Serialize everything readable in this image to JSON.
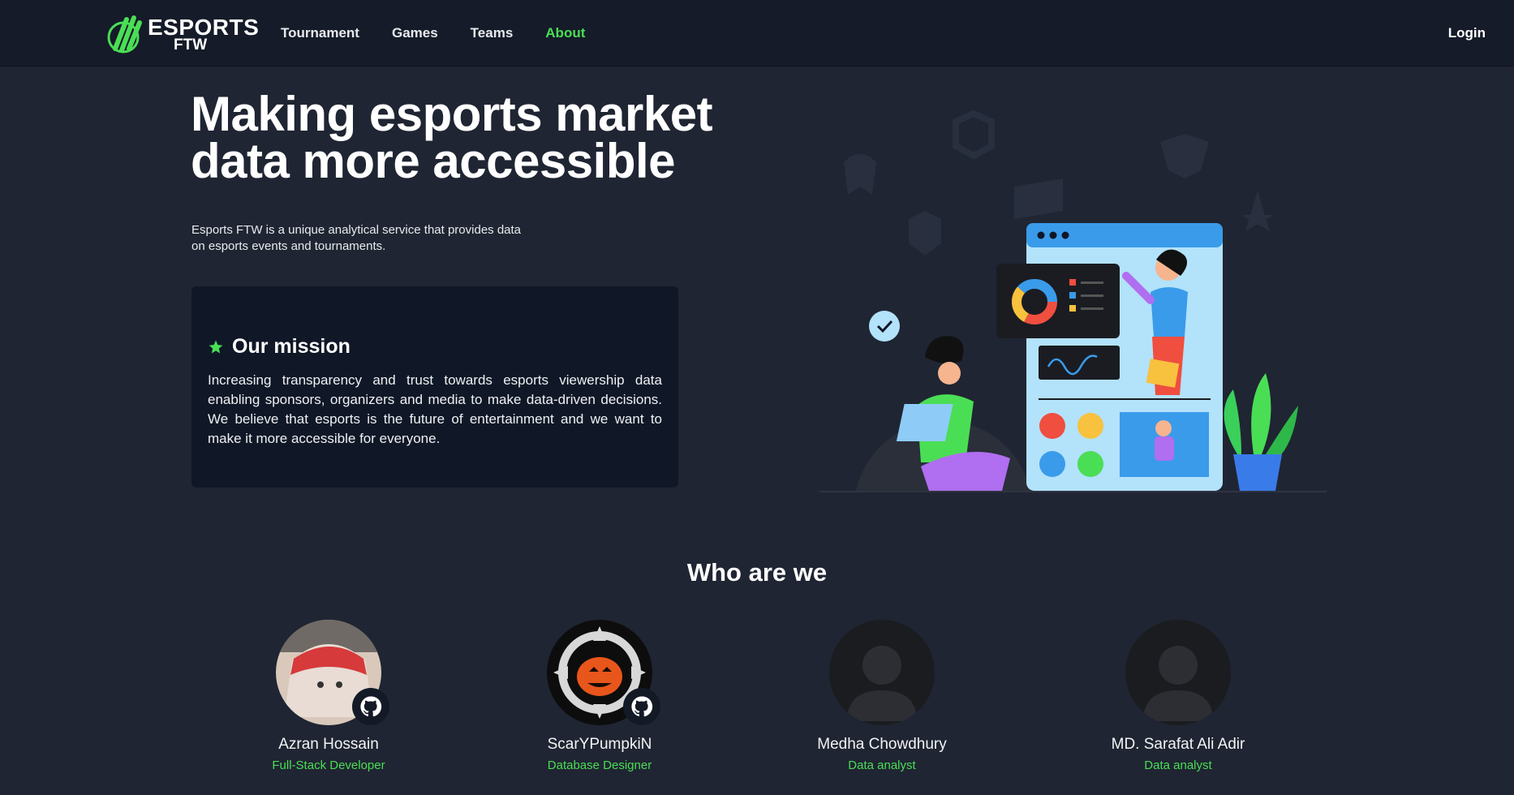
{
  "brand": {
    "line1": "ESPORTS",
    "line2": "FTW",
    "accent": "#4ade55"
  },
  "nav": {
    "links": [
      {
        "label": "Tournament",
        "active": false
      },
      {
        "label": "Games",
        "active": false
      },
      {
        "label": "Teams",
        "active": false
      },
      {
        "label": "About",
        "active": true
      }
    ],
    "login": "Login"
  },
  "hero": {
    "title_line1": "Making esports market",
    "title_line2": "data more accessible",
    "subtitle": "Esports FTW is a unique analytical service that provides data on esports events and tournaments."
  },
  "mission": {
    "icon": "star-icon",
    "title": "Our mission",
    "text": "Increasing transparency and trust towards esports viewership data enabling sponsors, organizers and media to make data-driven decisions. We believe that esports is the future of entertainment and we want to make it more accessible for everyone."
  },
  "team": {
    "heading": "Who are we",
    "members": [
      {
        "name": "Azran Hossain",
        "role": "Full-Stack Developer",
        "github": true
      },
      {
        "name": "ScarYPumpkiN",
        "role": "Database Designer",
        "github": true
      },
      {
        "name": "Medha Chowdhury",
        "role": "Data analyst",
        "github": false
      },
      {
        "name": "MD. Sarafat Ali Adir",
        "role": "Data analyst",
        "github": false
      }
    ]
  }
}
